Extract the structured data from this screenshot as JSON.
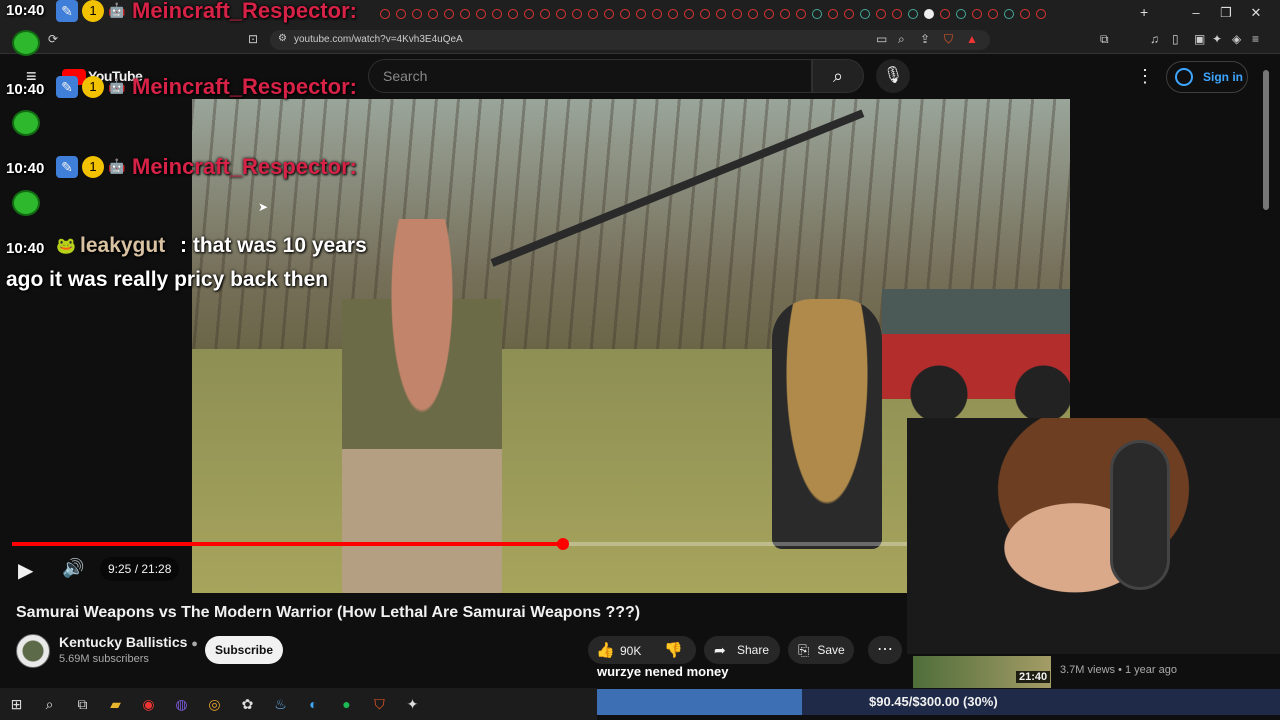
{
  "browser": {
    "url": "youtube.com/watch?v=4Kvh3E4uQeA",
    "window_controls": [
      "–",
      "❐",
      "✕"
    ],
    "new_tab": "+"
  },
  "youtube": {
    "logo": "YouTube",
    "search_placeholder": "Search",
    "signin": "Sign in"
  },
  "player": {
    "time": "9:25 / 21:28",
    "progress_fraction": 0.4406
  },
  "chat": [
    {
      "time": "10:40",
      "user": "Meincraft_Respector:",
      "message": ""
    },
    {
      "time": "10:40",
      "user": "Meincraft_Respector:",
      "message": ""
    },
    {
      "time": "10:40",
      "user": "Meincraft_Respector:",
      "message": ""
    },
    {
      "time": "10:40",
      "user": "leakygut",
      "message": ": that was 10 years",
      "message2": "ago it was really pricy back then"
    }
  ],
  "badge_label": "1",
  "video": {
    "title": "Samurai Weapons vs The Modern Warrior (How Lethal Are Samurai Weapons ???)",
    "channel": "Kentucky Ballistics",
    "subscribers": "5.69M subscribers",
    "subscribe_label": "Subscribe",
    "likes": "90K",
    "share_label": "Share",
    "save_label": "Save"
  },
  "recommended": {
    "duration": "21:40",
    "meta": "3.7M views • 1 year ago"
  },
  "donation": {
    "label": "wurzye nened money",
    "text": "$90.45/$300.00 (30%)",
    "fraction": 0.3
  },
  "colors": {
    "accent": "#ff0000",
    "chat_user": "#d62246",
    "link": "#3ea6ff"
  }
}
